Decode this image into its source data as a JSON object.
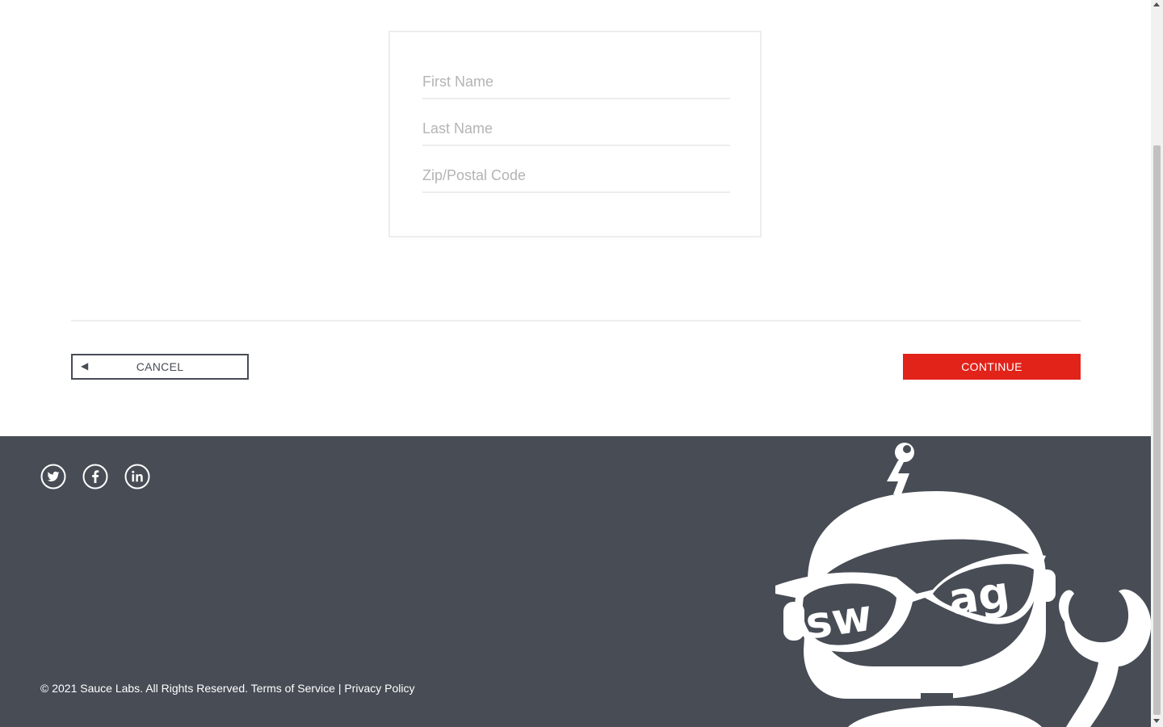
{
  "form": {
    "first_name_placeholder": "First Name",
    "last_name_placeholder": "Last Name",
    "zip_placeholder": "Zip/Postal Code",
    "first_name_value": "",
    "last_name_value": "",
    "zip_value": ""
  },
  "actions": {
    "cancel_label": "CANCEL",
    "cancel_icon": "◀",
    "continue_label": "CONTINUE"
  },
  "footer": {
    "social": [
      {
        "name": "twitter-icon"
      },
      {
        "name": "facebook-icon"
      },
      {
        "name": "linkedin-icon"
      }
    ],
    "copyright": "© 2021 Sauce Labs. All Rights Reserved.",
    "terms_label": "Terms of Service",
    "separator": "|",
    "privacy_label": "Privacy Policy",
    "mascot_text_left": "sw",
    "mascot_text_right": "ag"
  },
  "colors": {
    "accent": "#e2231a",
    "footer_bg": "#474c55",
    "border": "#ededed",
    "placeholder": "#b4b4b4"
  }
}
